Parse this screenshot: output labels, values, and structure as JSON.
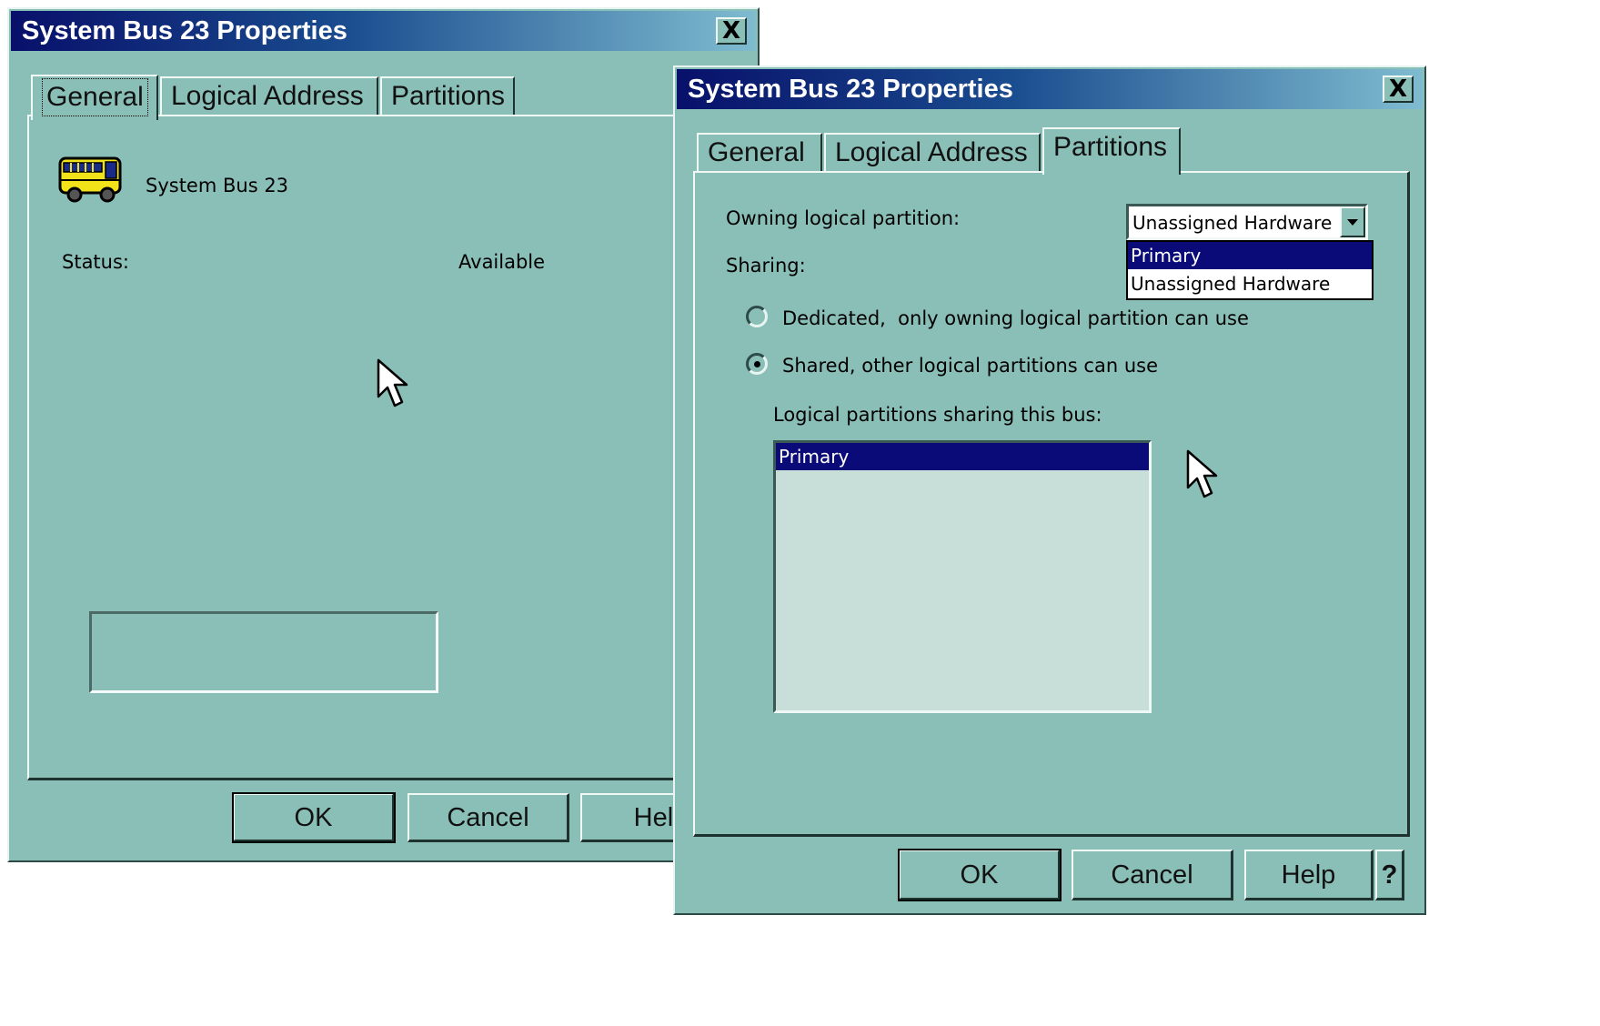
{
  "window1": {
    "title": "System Bus 23 Properties",
    "close_glyph": "X",
    "tabs": [
      {
        "label": "General",
        "active": true
      },
      {
        "label": "Logical Address",
        "active": false
      },
      {
        "label": "Partitions",
        "active": false
      }
    ],
    "device_icon": "bus-icon",
    "device_name": "System Bus 23",
    "status_label": "Status:",
    "status_value": "Available",
    "buttons": {
      "ok": "OK",
      "cancel": "Cancel",
      "help": "Help"
    }
  },
  "window2": {
    "title": "System Bus 23 Properties",
    "close_glyph": "X",
    "tabs": [
      {
        "label": "General",
        "active": false
      },
      {
        "label": "Logical Address",
        "active": false
      },
      {
        "label": "Partitions",
        "active": true
      }
    ],
    "owning_label": "Owning logical partition:",
    "owning_value": "Unassigned Hardware",
    "dropdown_options": [
      {
        "label": "Primary",
        "highlighted": true
      },
      {
        "label": "Unassigned Hardware",
        "highlighted": false
      }
    ],
    "sharing_label": "Sharing:",
    "radio_dedicated": {
      "label": "Dedicated,  only owning logical partition can use",
      "checked": false
    },
    "radio_shared": {
      "label": "Shared, other logical partitions can use",
      "checked": true
    },
    "sharing_list_label": "Logical partitions sharing this bus:",
    "sharing_list": [
      {
        "label": "Primary",
        "selected": true
      }
    ],
    "buttons": {
      "ok": "OK",
      "cancel": "Cancel",
      "help": "Help",
      "context_help": "?"
    }
  },
  "colors": {
    "dialog_background": "#8abfb8",
    "title_gradient_start": "#08106a",
    "selection": "#0a0a78",
    "listbox_background": "#c8dfd9"
  }
}
